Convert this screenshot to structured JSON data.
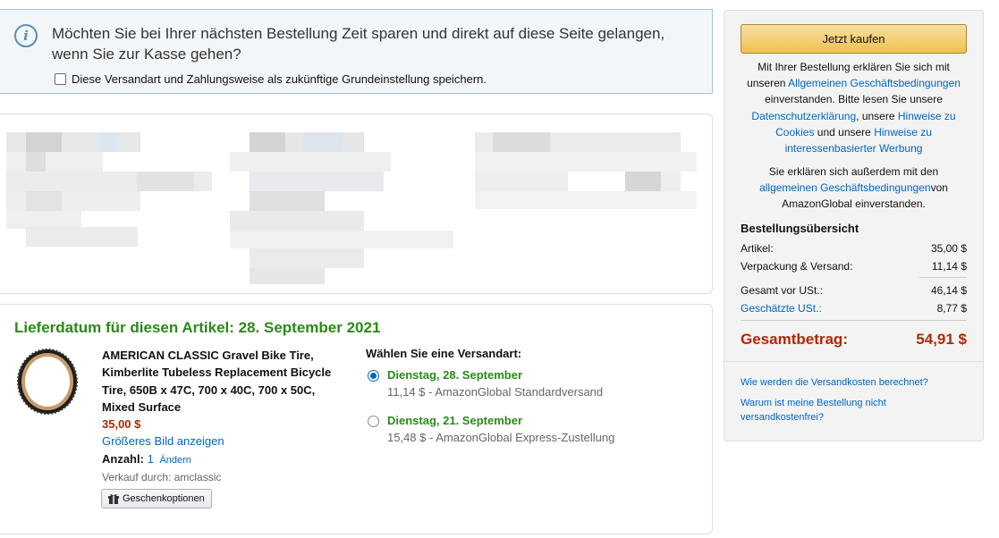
{
  "banner": {
    "headline": "Möchten Sie bei Ihrer nächsten Bestellung Zeit sparen und direkt auf diese Seite gelangen, wenn Sie zur Kasse gehen?",
    "checkbox_label": "Diese Versandart und Zahlungsweise als zukünftige Grundeinstellung speichern.",
    "checkbox_checked": false
  },
  "delivery": {
    "title": "Lieferdatum für diesen Artikel: 28. September 2021",
    "product": {
      "title": "AMERICAN CLASSIC Gravel Bike Tire, Kimberlite Tubeless Replacement Bicycle Tire, 650B x 47C, 700 x 40C, 700 x 50C, Mixed Surface",
      "price": "35,00 $",
      "bigger_image": "Größeres Bild anzeigen",
      "quantity_label": "Anzahl:",
      "quantity": "1",
      "change_label": "Ändern",
      "sold_by": "Verkauf durch: amclassic",
      "gift_button": "Geschenkoptionen"
    },
    "shipping": {
      "heading": "Wählen Sie eine Versandart:",
      "options": [
        {
          "date": "Dienstag, 28. September",
          "desc": "11,14 $ - AmazonGlobal Standardversand",
          "selected": true
        },
        {
          "date": "Dienstag, 21. September",
          "desc": "15,48 $ - AmazonGlobal Express-Zustellung",
          "selected": false
        }
      ]
    }
  },
  "summary": {
    "buy_button": "Jetzt kaufen",
    "legal1": {
      "t1": "Mit Ihrer Bestellung erklären Sie sich mit unseren ",
      "l1": "Allgemeinen Geschäftsbedingungen",
      "t2": " einverstanden. Bitte lesen Sie unsere ",
      "l2": "Datenschutzerklärung",
      "t3": ", unsere ",
      "l3": "Hinweise zu Cookies",
      "t4": " und unsere ",
      "l4": "Hinweise zu interessenbasierter Werbung"
    },
    "legal2": {
      "t1": "Sie erklären sich außerdem mit den ",
      "l1": "allgemeinen Geschäftsbedingungen",
      "t2": "von AmazonGlobal einverstanden."
    },
    "order_summary_title": "Bestellungsübersicht",
    "rows": [
      {
        "label": "Artikel:",
        "value": "35,00 $"
      },
      {
        "label": "Verpackung & Versand:",
        "value": "11,14 $"
      },
      {
        "label": "Gesamt vor USt.:",
        "value": "46,14 $"
      },
      {
        "label": "Geschätzte USt.:",
        "value": "8,77 $"
      }
    ],
    "total_label": "Gesamtbetrag:",
    "total_value": "54,91 $",
    "faq": [
      "Wie werden die Versandkosten berechnet?",
      "Warum ist meine Bestellung nicht versandkostenfrei?"
    ]
  },
  "icons": {
    "info": "info-icon",
    "gift": "gift-icon",
    "product_image": "bike-tire-image"
  },
  "colors": {
    "delivery_green": "#2a8a17",
    "price_red": "#b12704",
    "link_blue": "#0066c0",
    "buy_button": "#f0c14b"
  }
}
